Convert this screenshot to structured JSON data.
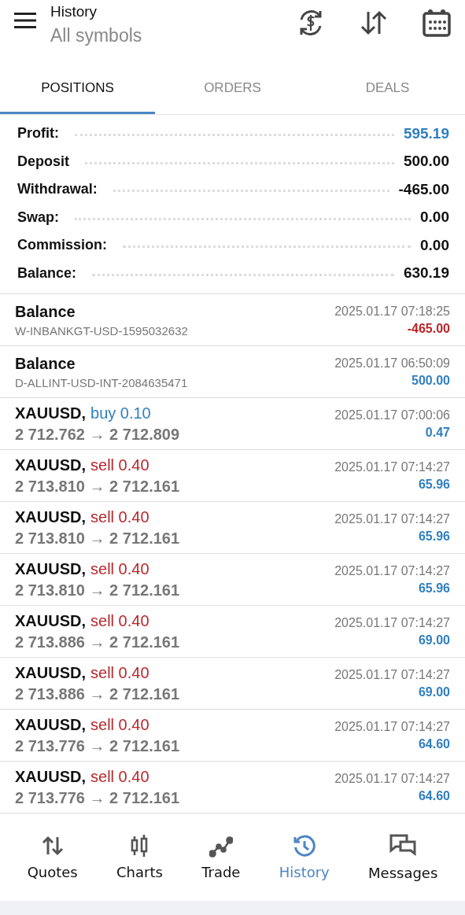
{
  "header": {
    "title": "History",
    "subtitle": "All symbols"
  },
  "tabs": [
    {
      "label": "POSITIONS",
      "selected": true
    },
    {
      "label": "ORDERS",
      "selected": false
    },
    {
      "label": "DEALS",
      "selected": false
    }
  ],
  "summary": [
    {
      "label": "Profit:",
      "value": "595.19",
      "highlight": true
    },
    {
      "label": "Deposit",
      "value": "500.00",
      "highlight": false
    },
    {
      "label": "Withdrawal:",
      "value": "-465.00",
      "highlight": false
    },
    {
      "label": "Swap:",
      "value": "0.00",
      "highlight": false
    },
    {
      "label": "Commission:",
      "value": "0.00",
      "highlight": false
    },
    {
      "label": "Balance:",
      "value": "630.19",
      "highlight": false
    }
  ],
  "rows": [
    {
      "kind": "balance",
      "title": "Balance",
      "detail": "W-INBANKGT-USD-1595032632",
      "time": "2025.01.17 07:18:25",
      "amount": "-465.00",
      "loss": true
    },
    {
      "kind": "balance",
      "title": "Balance",
      "detail": "D-ALLINT-USD-INT-2084635471",
      "time": "2025.01.17 06:50:09",
      "amount": "500.00",
      "loss": false
    },
    {
      "kind": "trade",
      "title": "XAUUSD,",
      "buy": true,
      "action": "buy 0.10",
      "detail": "2 712.762 → 2 712.809",
      "time": "2025.01.17 07:00:06",
      "amount": "0.47",
      "loss": false
    },
    {
      "kind": "trade",
      "title": "XAUUSD,",
      "buy": false,
      "action": "sell 0.40",
      "detail": "2 713.810 → 2 712.161",
      "time": "2025.01.17 07:14:27",
      "amount": "65.96",
      "loss": false
    },
    {
      "kind": "trade",
      "title": "XAUUSD,",
      "buy": false,
      "action": "sell 0.40",
      "detail": "2 713.810 → 2 712.161",
      "time": "2025.01.17 07:14:27",
      "amount": "65.96",
      "loss": false
    },
    {
      "kind": "trade",
      "title": "XAUUSD,",
      "buy": false,
      "action": "sell 0.40",
      "detail": "2 713.810 → 2 712.161",
      "time": "2025.01.17 07:14:27",
      "amount": "65.96",
      "loss": false
    },
    {
      "kind": "trade",
      "title": "XAUUSD,",
      "buy": false,
      "action": "sell 0.40",
      "detail": "2 713.886 → 2 712.161",
      "time": "2025.01.17 07:14:27",
      "amount": "69.00",
      "loss": false
    },
    {
      "kind": "trade",
      "title": "XAUUSD,",
      "buy": false,
      "action": "sell 0.40",
      "detail": "2 713.886 → 2 712.161",
      "time": "2025.01.17 07:14:27",
      "amount": "69.00",
      "loss": false
    },
    {
      "kind": "trade",
      "title": "XAUUSD,",
      "buy": false,
      "action": "sell 0.40",
      "detail": "2 713.776 → 2 712.161",
      "time": "2025.01.17 07:14:27",
      "amount": "64.60",
      "loss": false
    },
    {
      "kind": "trade",
      "title": "XAUUSD,",
      "buy": false,
      "action": "sell 0.40",
      "detail": "2 713.776 → 2 712.161",
      "time": "2025.01.17 07:14:27",
      "amount": "64.60",
      "loss": false
    }
  ],
  "nav": [
    {
      "kind": "quotes",
      "label": "Quotes",
      "selected": false
    },
    {
      "kind": "charts",
      "label": "Charts",
      "selected": false
    },
    {
      "kind": "trade",
      "label": "Trade",
      "selected": false
    },
    {
      "kind": "history",
      "label": "History",
      "selected": true
    },
    {
      "kind": "messages",
      "label": "Messages",
      "selected": false
    }
  ]
}
